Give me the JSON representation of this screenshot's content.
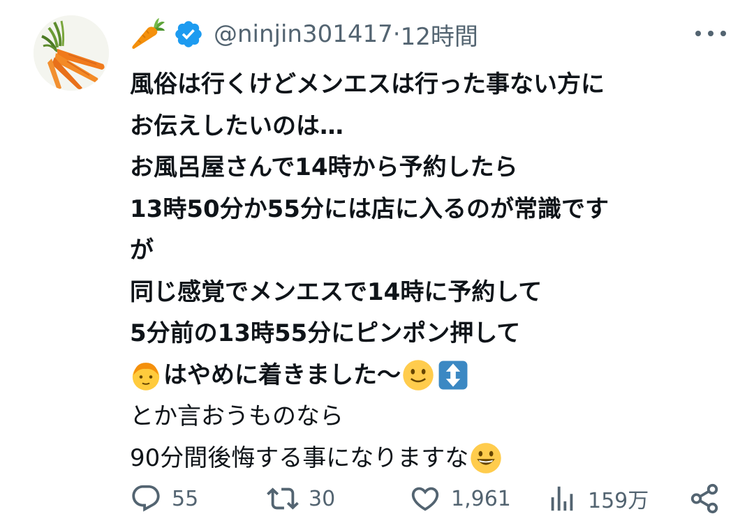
{
  "author": {
    "handle": "@ninjin301417",
    "time_sep": " · ",
    "time": "12時間",
    "name_icon": "carrot-emoji",
    "verified_icon": "verified-badge",
    "avatar_icon": "carrots-photo"
  },
  "tweet": {
    "lines": [
      "風俗は行くけどメンエスは行った事ない方に",
      "お伝えしたいのは…",
      "お風呂屋さんで14時から予約したら",
      "13時50分か55分には店に入るのが常識です",
      "が",
      "同じ感覚でメンエスで14時に予約して",
      "5分前の13時55分にピンポン押して",
      "はやめに着きました〜",
      "とか言おうものなら",
      "90分間後悔する事になりますな"
    ],
    "emojis": {
      "line8_start": "boy-face-emoji",
      "line8_end_1": "slightly-smiling-face-emoji",
      "line8_end_2": "up-down-arrow-emoji",
      "line10_end": "grinning-face-emoji"
    }
  },
  "actions": {
    "reply_count": "55",
    "retweet_count": "30",
    "like_count": "1,961",
    "views_count": "159万",
    "icons": [
      "reply-icon",
      "retweet-icon",
      "like-icon",
      "views-icon",
      "share-icon"
    ]
  },
  "colors": {
    "text": "#0f1419",
    "secondary": "#536471",
    "verified": "#1d9bf0",
    "carrot": "#f08a24",
    "emoji_yellow": "#ffcb3d",
    "arrow_box": "#3b88c3"
  }
}
